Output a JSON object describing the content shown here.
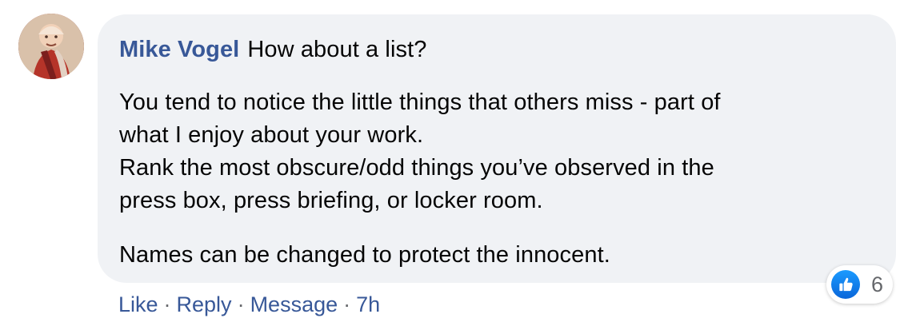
{
  "comment": {
    "author": "Mike Vogel",
    "headline": "How about a list?",
    "paragraphs": [
      "You tend to notice the little things that others miss - part of\nwhat I enjoy about your work.\nRank the most obscure/odd things you’ve observed in the\npress box, press briefing, or locker room.",
      "Names can be changed to protect the innocent."
    ],
    "reaction": {
      "icon": "thumbs-up-icon",
      "count": "6"
    },
    "actions": {
      "like": "Like",
      "reply": "Reply",
      "message": "Message",
      "separator": "·",
      "time": "7h"
    }
  },
  "theme": {
    "link_color": "#385898",
    "bubble_color": "#f0f2f5",
    "text_color": "#050505",
    "meta_color": "#65676b",
    "reaction_blue": "#1877f2"
  },
  "icons": {
    "avatar": "profile-photo",
    "like": "thumbs-up-icon"
  }
}
